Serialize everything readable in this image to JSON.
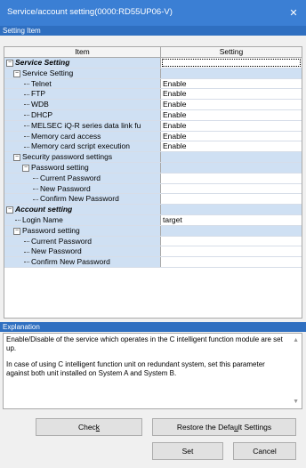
{
  "window": {
    "title": "Service/account setting(0000:RD55UP06-V)",
    "close_glyph": "✕"
  },
  "setting_item_header": "Setting Item",
  "grid": {
    "col_item": "Item",
    "col_setting": "Setting",
    "rows": [
      {
        "label": "Service Setting",
        "setting": ""
      },
      {
        "label": "Service Setting",
        "setting": ""
      },
      {
        "label": "Telnet",
        "setting": "Enable"
      },
      {
        "label": "FTP",
        "setting": "Enable"
      },
      {
        "label": "WDB",
        "setting": "Enable"
      },
      {
        "label": "DHCP",
        "setting": "Enable"
      },
      {
        "label": "MELSEC iQ-R series data link fu",
        "setting": "Enable"
      },
      {
        "label": "Memory card access",
        "setting": "Enable"
      },
      {
        "label": "Memory card script execution",
        "setting": "Enable"
      },
      {
        "label": "Security password settings",
        "setting": ""
      },
      {
        "label": "Password setting",
        "setting": ""
      },
      {
        "label": "Current Password",
        "setting": ""
      },
      {
        "label": "New Password",
        "setting": ""
      },
      {
        "label": "Confirm New Password",
        "setting": ""
      },
      {
        "label": "Account setting",
        "setting": ""
      },
      {
        "label": "Login Name",
        "setting": "target"
      },
      {
        "label": "Password setting",
        "setting": ""
      },
      {
        "label": "Current Password",
        "setting": ""
      },
      {
        "label": "New Password",
        "setting": ""
      },
      {
        "label": "Confirm New Password",
        "setting": ""
      }
    ]
  },
  "explanation": {
    "header": "Explanation",
    "para1": "Enable/Disable of the service which operates in the C intelligent function module are set up.",
    "para2": "In case of using C intelligent function unit on redundant system, set this parameter against both unit installed on System A and System B."
  },
  "buttons": {
    "check_pre": "Chec",
    "check_key": "k",
    "restore_pre": "Restore the Defa",
    "restore_key": "u",
    "restore_post": "lt Settings",
    "set": "Set",
    "cancel": "Cancel"
  },
  "colors": {
    "titlebar": "#3b7fd4",
    "section_header": "#2f6fc0",
    "group_cell": "#cfe0f3"
  }
}
